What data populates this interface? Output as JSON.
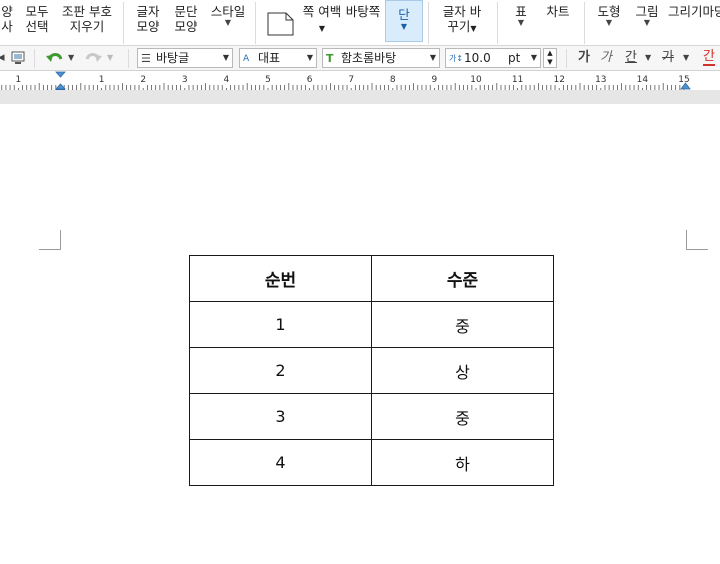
{
  "ribbon": {
    "items": [
      {
        "id": "copy",
        "line1": "양",
        "line2": "사"
      },
      {
        "id": "select_all",
        "line1": "모두",
        "line2": "선택"
      },
      {
        "id": "clear_marks",
        "line1": "조판 부호",
        "line2": "지우기"
      },
      {
        "id": "char_shape",
        "line1": "글자",
        "line2": "모양"
      },
      {
        "id": "para_shape",
        "line1": "문단",
        "line2": "모양"
      },
      {
        "id": "style",
        "line1": "스타일",
        "line2": ""
      },
      {
        "id": "page_margin",
        "line1": "쪽",
        "line2": "여백"
      },
      {
        "id": "background_page",
        "line1": "바탕쪽",
        "line2": ""
      },
      {
        "id": "column",
        "line1": "단",
        "line2": ""
      },
      {
        "id": "char_change",
        "line1": "글자",
        "line2": "바꾸기"
      },
      {
        "id": "table",
        "line1": "표",
        "line2": ""
      },
      {
        "id": "chart",
        "line1": "차트",
        "line2": ""
      },
      {
        "id": "shape",
        "line1": "도형",
        "line2": ""
      },
      {
        "id": "picture",
        "line1": "그림",
        "line2": ""
      },
      {
        "id": "draw",
        "line1": "그리기마당",
        "line2": ""
      }
    ]
  },
  "toolbar": {
    "style_value": "바탕글",
    "lang_value": "대표",
    "font_value": "함초롬바탕",
    "size_value": "10.0",
    "size_unit": "pt",
    "bold_label": "가",
    "italic_label": "가",
    "underline_label": "간",
    "strike_label": "가",
    "color_label": "간"
  },
  "ruler": {
    "labels": [
      "1",
      "1",
      "2",
      "3",
      "4",
      "5",
      "6",
      "7",
      "8",
      "9",
      "10",
      "11",
      "12",
      "13",
      "14",
      "15"
    ]
  },
  "table": {
    "headers": [
      "순번",
      "수준"
    ],
    "rows": [
      [
        "1",
        "중"
      ],
      [
        "2",
        "상"
      ],
      [
        "3",
        "중"
      ],
      [
        "4",
        "하"
      ]
    ]
  },
  "colors": {
    "active_tab_bg": "#d9ecfb",
    "undo_green": "#3e9a2e",
    "strike_red": "#d0312d"
  }
}
